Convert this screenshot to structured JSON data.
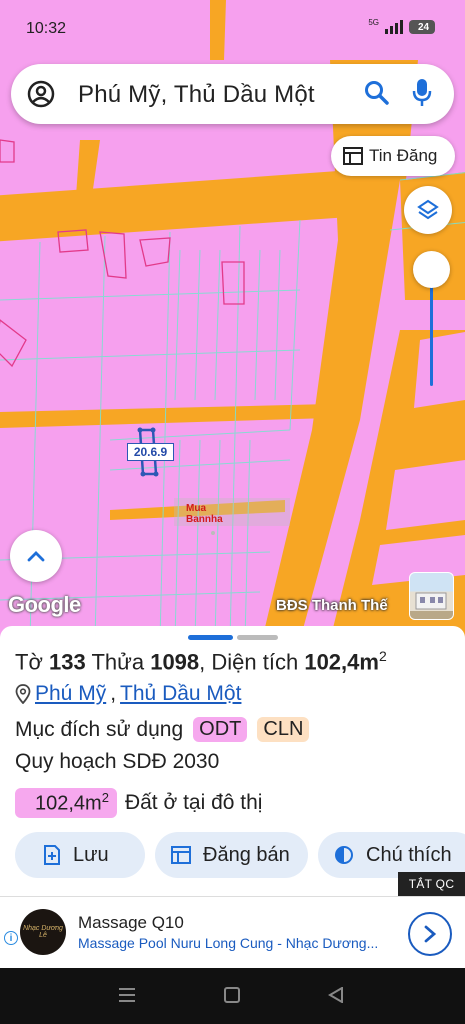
{
  "status_bar": {
    "time": "10:32",
    "network": "5G",
    "battery": "24"
  },
  "search": {
    "query": "Phú Mỹ, Thủ Dầu Một"
  },
  "map": {
    "tin_dang_label": "Tin Đăng",
    "parcel_label": "20.6.9",
    "watermark": [
      "Mua",
      "Bannha"
    ],
    "google_logo": "Google",
    "bds_label": "BĐS Thanh Thế",
    "colors": {
      "residential": "#f6a0ee",
      "road": "#f7a624",
      "boundary": "#7de0d0"
    }
  },
  "sheet": {
    "title": {
      "to_label": "Tờ",
      "to_number": "133",
      "thua_label": "Thửa",
      "thua_number": "1098",
      "dien_tich_label": ", Diện tích",
      "area_value": "102,4m",
      "area_sup": "2"
    },
    "location": {
      "ward": "Phú Mỹ",
      "separator": ",",
      "city": "Thủ Dầu Một"
    },
    "purpose_label": "Mục đích sử dụng",
    "purpose_tags": [
      "ODT",
      "CLN"
    ],
    "plan_label": "Quy hoạch SDĐ 2030",
    "area_chip": {
      "value": "102,4m",
      "sup": "2",
      "description": "Đất ở tại đô thị"
    },
    "actions": {
      "save": "Lưu",
      "sell": "Đăng bán",
      "legend": "Chú thích"
    }
  },
  "ad": {
    "close_label": "TẮT QC",
    "logo_text": "Nhạc Dương Lê",
    "title": "Massage Q10",
    "description": "Massage Pool Nuru Long Cung - Nhạc Dương..."
  }
}
